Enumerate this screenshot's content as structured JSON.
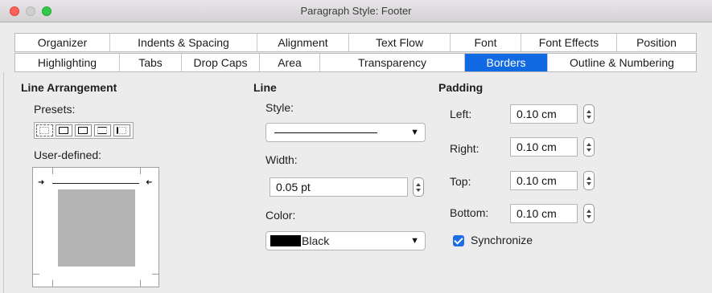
{
  "window": {
    "title": "Paragraph Style: Footer"
  },
  "tabs_row1": [
    "Organizer",
    "Indents & Spacing",
    "Alignment",
    "Text Flow",
    "Font",
    "Font Effects",
    "Position"
  ],
  "tabs_row2": [
    "Highlighting",
    "Tabs",
    "Drop Caps",
    "Area",
    "Transparency",
    "Borders",
    "Outline & Numbering"
  ],
  "active_tab": "Borders",
  "line_arrangement": {
    "title": "Line Arrangement",
    "presets_label": "Presets:",
    "user_defined_label": "User-defined:"
  },
  "line": {
    "title": "Line",
    "style_label": "Style:",
    "width_label": "Width:",
    "width_value": "0.05 pt",
    "color_label": "Color:",
    "color_value": "Black",
    "color_hex": "#000000"
  },
  "padding": {
    "title": "Padding",
    "left_label": "Left:",
    "left_value": "0.10 cm",
    "right_label": "Right:",
    "right_value": "0.10 cm",
    "top_label": "Top:",
    "top_value": "0.10 cm",
    "bottom_label": "Bottom:",
    "bottom_value": "0.10 cm",
    "synchronize_label": "Synchronize",
    "synchronize_checked": true
  },
  "colors": {
    "accent": "#1169e3"
  }
}
